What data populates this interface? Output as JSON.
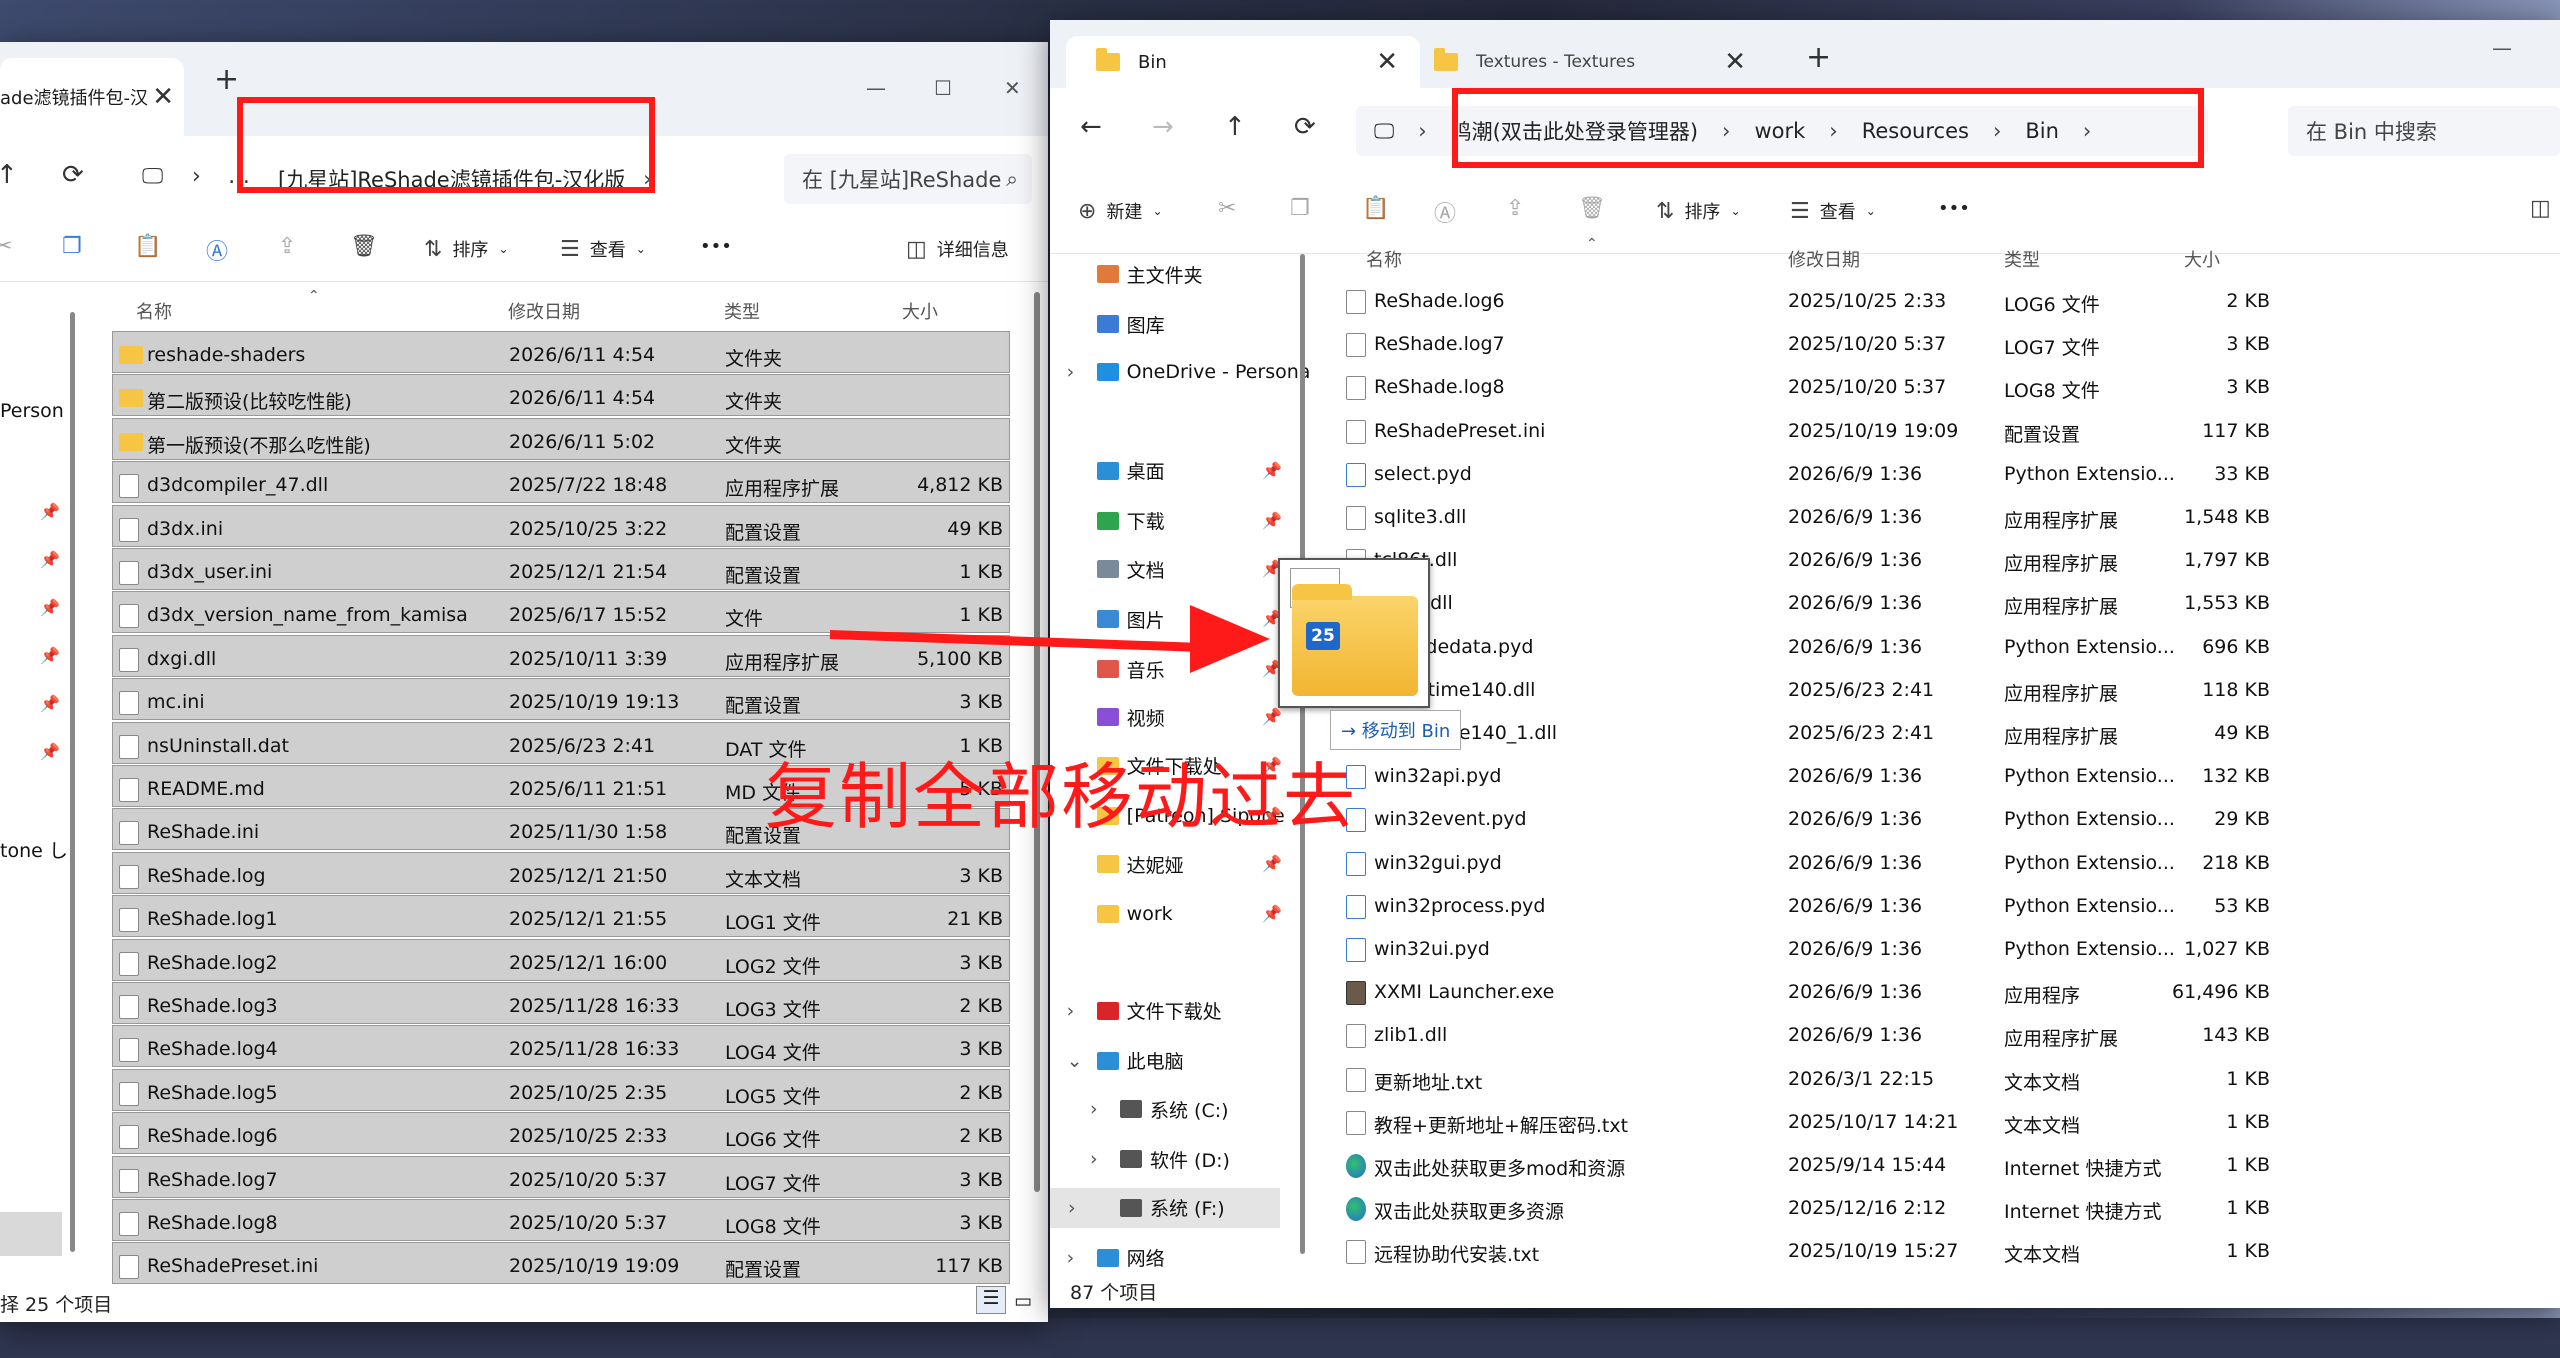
{
  "left": {
    "tab_title": "ade滤镜插件包-汉",
    "path": "[九星站]ReShade滤镜插件包-汉化版",
    "search": "在 [九星站]ReShade",
    "toolbar": {
      "sort": "排序",
      "view": "查看",
      "more": "•••",
      "details": "详细信息"
    },
    "columns": {
      "name": "名称",
      "date": "修改日期",
      "type": "类型",
      "size": "大小"
    },
    "side_labels": [
      {
        "label": "Person"
      },
      {
        "label": "tone し"
      }
    ],
    "files": [
      {
        "name": "reshade-shaders",
        "date": "2026/6/11 4:54",
        "type": "文件夹",
        "size": "",
        "icon": "folder"
      },
      {
        "name": "第二版预设(比较吃性能)",
        "date": "2026/6/11 4:54",
        "type": "文件夹",
        "size": "",
        "icon": "folder"
      },
      {
        "name": "第一版预设(不那么吃性能)",
        "date": "2026/6/11 5:02",
        "type": "文件夹",
        "size": "",
        "icon": "folder"
      },
      {
        "name": "d3dcompiler_47.dll",
        "date": "2025/7/22 18:48",
        "type": "应用程序扩展",
        "size": "4,812 KB",
        "icon": "file"
      },
      {
        "name": "d3dx.ini",
        "date": "2025/10/25 3:22",
        "type": "配置设置",
        "size": "49 KB",
        "icon": "file"
      },
      {
        "name": "d3dx_user.ini",
        "date": "2025/12/1 21:54",
        "type": "配置设置",
        "size": "1 KB",
        "icon": "file"
      },
      {
        "name": "d3dx_version_name_from_kamisa",
        "date": "2025/6/17 15:52",
        "type": "文件",
        "size": "1 KB",
        "icon": "file"
      },
      {
        "name": "dxgi.dll",
        "date": "2025/10/11 3:39",
        "type": "应用程序扩展",
        "size": "5,100 KB",
        "icon": "file"
      },
      {
        "name": "mc.ini",
        "date": "2025/10/19 19:13",
        "type": "配置设置",
        "size": "3 KB",
        "icon": "file"
      },
      {
        "name": "nsUninstall.dat",
        "date": "2025/6/23 2:41",
        "type": "DAT 文件",
        "size": "1 KB",
        "icon": "file"
      },
      {
        "name": "README.md",
        "date": "2025/6/11 21:51",
        "type": "MD 文件",
        "size": "5 KB",
        "icon": "file"
      },
      {
        "name": "ReShade.ini",
        "date": "2025/11/30 1:58",
        "type": "配置设置",
        "size": "",
        "icon": "file"
      },
      {
        "name": "ReShade.log",
        "date": "2025/12/1 21:50",
        "type": "文本文档",
        "size": "3 KB",
        "icon": "file"
      },
      {
        "name": "ReShade.log1",
        "date": "2025/12/1 21:55",
        "type": "LOG1 文件",
        "size": "21 KB",
        "icon": "file"
      },
      {
        "name": "ReShade.log2",
        "date": "2025/12/1 16:00",
        "type": "LOG2 文件",
        "size": "3 KB",
        "icon": "file"
      },
      {
        "name": "ReShade.log3",
        "date": "2025/11/28 16:33",
        "type": "LOG3 文件",
        "size": "2 KB",
        "icon": "file"
      },
      {
        "name": "ReShade.log4",
        "date": "2025/11/28 16:33",
        "type": "LOG4 文件",
        "size": "3 KB",
        "icon": "file"
      },
      {
        "name": "ReShade.log5",
        "date": "2025/10/25 2:35",
        "type": "LOG5 文件",
        "size": "2 KB",
        "icon": "file"
      },
      {
        "name": "ReShade.log6",
        "date": "2025/10/25 2:33",
        "type": "LOG6 文件",
        "size": "2 KB",
        "icon": "file"
      },
      {
        "name": "ReShade.log7",
        "date": "2025/10/20 5:37",
        "type": "LOG7 文件",
        "size": "3 KB",
        "icon": "file"
      },
      {
        "name": "ReShade.log8",
        "date": "2025/10/20 5:37",
        "type": "LOG8 文件",
        "size": "3 KB",
        "icon": "file"
      },
      {
        "name": "ReShadePreset.ini",
        "date": "2025/10/19 19:09",
        "type": "配置设置",
        "size": "117 KB",
        "icon": "file"
      }
    ],
    "status": "择 25 个项目"
  },
  "right": {
    "tab1": "Bin",
    "tab2": "Textures - Textures",
    "crumbs": [
      "鸣潮(双击此处登录管理器)",
      "work",
      "Resources",
      "Bin"
    ],
    "search": "在 Bin 中搜索",
    "toolbar": {
      "new": "新建",
      "sort": "排序",
      "view": "查看",
      "more": "•••"
    },
    "columns": {
      "name": "名称",
      "date": "修改日期",
      "type": "类型",
      "size": "大小"
    },
    "sidebar": [
      {
        "label": "主文件夹",
        "icon": "home"
      },
      {
        "label": "图库",
        "icon": "gallery"
      },
      {
        "label": "OneDrive - Persona",
        "icon": "cloud"
      },
      {
        "label": "桌面",
        "icon": "desktop"
      },
      {
        "label": "下载",
        "icon": "download"
      },
      {
        "label": "文档",
        "icon": "docs"
      },
      {
        "label": "图片",
        "icon": "pictures"
      },
      {
        "label": "音乐",
        "icon": "music"
      },
      {
        "label": "视频",
        "icon": "video"
      },
      {
        "label": "文件下载处",
        "icon": "folder"
      },
      {
        "label": "[Patreon] Sipone",
        "icon": "folder"
      },
      {
        "label": "达妮娅",
        "icon": "folder"
      },
      {
        "label": "work",
        "icon": "folder"
      },
      {
        "label": "文件下载处",
        "icon": "mega"
      },
      {
        "label": "此电脑",
        "icon": "pc"
      },
      {
        "label": "系统 (C:)",
        "icon": "drive"
      },
      {
        "label": "软件 (D:)",
        "icon": "drive"
      },
      {
        "label": "系统 (F:)",
        "icon": "drive"
      },
      {
        "label": "网络",
        "icon": "network"
      }
    ],
    "files": [
      {
        "name": "ReShade.log6",
        "date": "2025/10/25 2:33",
        "type": "LOG6 文件",
        "size": "2 KB",
        "icon": "file"
      },
      {
        "name": "ReShade.log7",
        "date": "2025/10/20 5:37",
        "type": "LOG7 文件",
        "size": "3 KB",
        "icon": "file"
      },
      {
        "name": "ReShade.log8",
        "date": "2025/10/20 5:37",
        "type": "LOG8 文件",
        "size": "3 KB",
        "icon": "file"
      },
      {
        "name": "ReShadePreset.ini",
        "date": "2025/10/19 19:09",
        "type": "配置设置",
        "size": "117 KB",
        "icon": "file"
      },
      {
        "name": "select.pyd",
        "date": "2026/6/9 1:36",
        "type": "Python Extensio...",
        "size": "33 KB",
        "icon": "py"
      },
      {
        "name": "sqlite3.dll",
        "date": "2026/6/9 1:36",
        "type": "应用程序扩展",
        "size": "1,548 KB",
        "icon": "file"
      },
      {
        "name": "tcl86t.dll",
        "date": "2026/6/9 1:36",
        "type": "应用程序扩展",
        "size": "1,797 KB",
        "icon": "file"
      },
      {
        "name": "tk86t.dll",
        "date": "2026/6/9 1:36",
        "type": "应用程序扩展",
        "size": "1,553 KB",
        "icon": "file"
      },
      {
        "name": "unicodedata.pyd",
        "date": "2026/6/9 1:36",
        "type": "Python Extensio...",
        "size": "696 KB",
        "icon": "py"
      },
      {
        "name": "vcruntime140.dll",
        "date": "2025/6/23 2:41",
        "type": "应用程序扩展",
        "size": "118 KB",
        "icon": "file"
      },
      {
        "name": "vcruntime140_1.dll",
        "date": "2025/6/23 2:41",
        "type": "应用程序扩展",
        "size": "49 KB",
        "icon": "file"
      },
      {
        "name": "win32api.pyd",
        "date": "2026/6/9 1:36",
        "type": "Python Extensio...",
        "size": "132 KB",
        "icon": "py"
      },
      {
        "name": "win32event.pyd",
        "date": "2026/6/9 1:36",
        "type": "Python Extensio...",
        "size": "29 KB",
        "icon": "py"
      },
      {
        "name": "win32gui.pyd",
        "date": "2026/6/9 1:36",
        "type": "Python Extensio...",
        "size": "218 KB",
        "icon": "py"
      },
      {
        "name": "win32process.pyd",
        "date": "2026/6/9 1:36",
        "type": "Python Extensio...",
        "size": "53 KB",
        "icon": "py"
      },
      {
        "name": "win32ui.pyd",
        "date": "2026/6/9 1:36",
        "type": "Python Extensio...",
        "size": "1,027 KB",
        "icon": "py"
      },
      {
        "name": "XXMI Launcher.exe",
        "date": "2026/6/9 1:36",
        "type": "应用程序",
        "size": "61,496 KB",
        "icon": "exe"
      },
      {
        "name": "zlib1.dll",
        "date": "2026/6/9 1:36",
        "type": "应用程序扩展",
        "size": "143 KB",
        "icon": "file"
      },
      {
        "name": "更新地址.txt",
        "date": "2026/3/1 22:15",
        "type": "文本文档",
        "size": "1 KB",
        "icon": "file"
      },
      {
        "name": "教程+更新地址+解压密码.txt",
        "date": "2025/10/17 14:21",
        "type": "文本文档",
        "size": "1 KB",
        "icon": "file"
      },
      {
        "name": "双击此处获取更多mod和资源",
        "date": "2025/9/14 15:44",
        "type": "Internet 快捷方式",
        "size": "1 KB",
        "icon": "web"
      },
      {
        "name": "双击此处获取更多资源",
        "date": "2025/12/16 2:12",
        "type": "Internet 快捷方式",
        "size": "1 KB",
        "icon": "web"
      },
      {
        "name": "远程协助代安装.txt",
        "date": "2025/10/19 15:27",
        "type": "文本文档",
        "size": "1 KB",
        "icon": "file"
      }
    ],
    "status": "87 个项目"
  },
  "drag": {
    "badge": "25",
    "tooltip": "→ 移动到 Bin"
  },
  "annotation": {
    "caption": "复制全部移动过去",
    "color": "#ff1a1a"
  }
}
